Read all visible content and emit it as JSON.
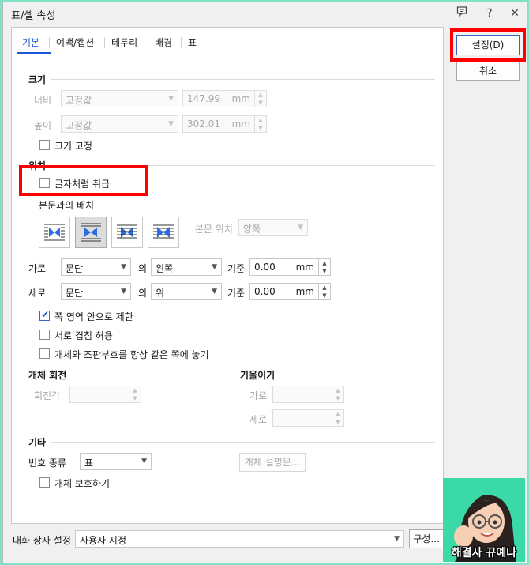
{
  "window": {
    "title": "표/셀 속성"
  },
  "titlebar": {
    "help_glyph": "?",
    "close_glyph": "✕"
  },
  "tabs": [
    {
      "label": "기본"
    },
    {
      "label": "여백/캡션"
    },
    {
      "label": "테두리"
    },
    {
      "label": "배경"
    },
    {
      "label": "표"
    }
  ],
  "size": {
    "header": "크기",
    "width_label": "너비",
    "width_mode": "고정값",
    "width_value": "147.99",
    "width_unit": "mm",
    "height_label": "높이",
    "height_mode": "고정값",
    "height_value": "302.01",
    "height_unit": "mm",
    "fix_size_label": "크기 고정"
  },
  "position": {
    "header": "위치",
    "treat_as_char_label": "글자처럼 취급",
    "layout_label": "본문과의 배치",
    "text_position_label": "본문 위치",
    "text_position_value": "양쪽",
    "horiz_label": "가로",
    "horiz_ref": "문단",
    "horiz_of": "의",
    "horiz_align": "왼쪽",
    "horiz_basis": "기준",
    "horiz_value": "0.00",
    "horiz_unit": "mm",
    "vert_label": "세로",
    "vert_ref": "문단",
    "vert_of": "의",
    "vert_align": "위",
    "vert_basis": "기준",
    "vert_value": "0.00",
    "vert_unit": "mm",
    "limit_page_label": "쪽 영역 안으로 제한",
    "allow_overlap_label": "서로 겹침 허용",
    "keep_anchor_label": "개체와 조판부호를 항상 같은 쪽에 놓기"
  },
  "rotation": {
    "header": "개체 회전",
    "angle_label": "회전각"
  },
  "skew": {
    "header": "기울이기",
    "horiz_label": "가로",
    "vert_label": "세로"
  },
  "other": {
    "header": "기타",
    "number_type_label": "번호 종류",
    "number_type_value": "표",
    "description_button": "개체 설명문...",
    "protect_label": "개체 보호하기"
  },
  "right_buttons": {
    "ok": "설정(D)",
    "cancel": "취소"
  },
  "footer": {
    "settings_label": "대화 상자 설정",
    "settings_value": "사용자 지정",
    "config_button": "구성..."
  },
  "avatar": {
    "caption": "해결사 뀨예나"
  },
  "state": {
    "limit_page_checked": true,
    "selected_wrap_index": 1
  },
  "colors": {
    "accent": "#1a56d6",
    "highlight": "#ff0000",
    "background": "#7fe3c8"
  }
}
